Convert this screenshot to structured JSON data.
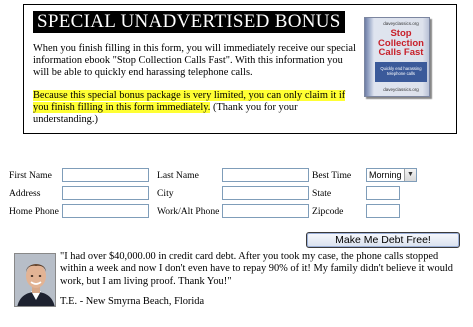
{
  "bonus": {
    "title": "SPECIAL UNADVERTISED BONUS",
    "paragraph1": "When you finish filling in this form, you will immediately receive our special information ebook \"Stop Collection Calls Fast\".  With this information you will be able to quickly end harassing telephone calls.",
    "highlight": "Because this special bonus package is very limited, you can only claim it if you finish filling in this form immediately.",
    "paragraph2_rest": "  (Thank you for your understanding.)"
  },
  "ebook": {
    "publisher": "daveyclassics.org",
    "title": "Stop Collection Calls Fast",
    "subtitle": "Quickly end harassing telephone calls",
    "footer": "daveyclassics.org"
  },
  "form": {
    "first_name_label": "First Name",
    "last_name_label": "Last Name",
    "best_time_label": "Best Time",
    "address_label": "Address",
    "city_label": "City",
    "state_label": "State",
    "home_phone_label": "Home Phone",
    "work_phone_label": "Work/Alt Phone",
    "zipcode_label": "Zipcode",
    "best_time_value": "Morning",
    "submit_label": "Make Me Debt Free!"
  },
  "testimonial": {
    "quote": "\"I had over $40,000.00 in credit card debt. After you took my case, the phone calls stopped within a week and now I don't even have to repay 90% of it! My family didn't believe it would work, but I am living proof.  Thank You!\"",
    "author": "T.E. - New Smyrna Beach, Florida"
  }
}
